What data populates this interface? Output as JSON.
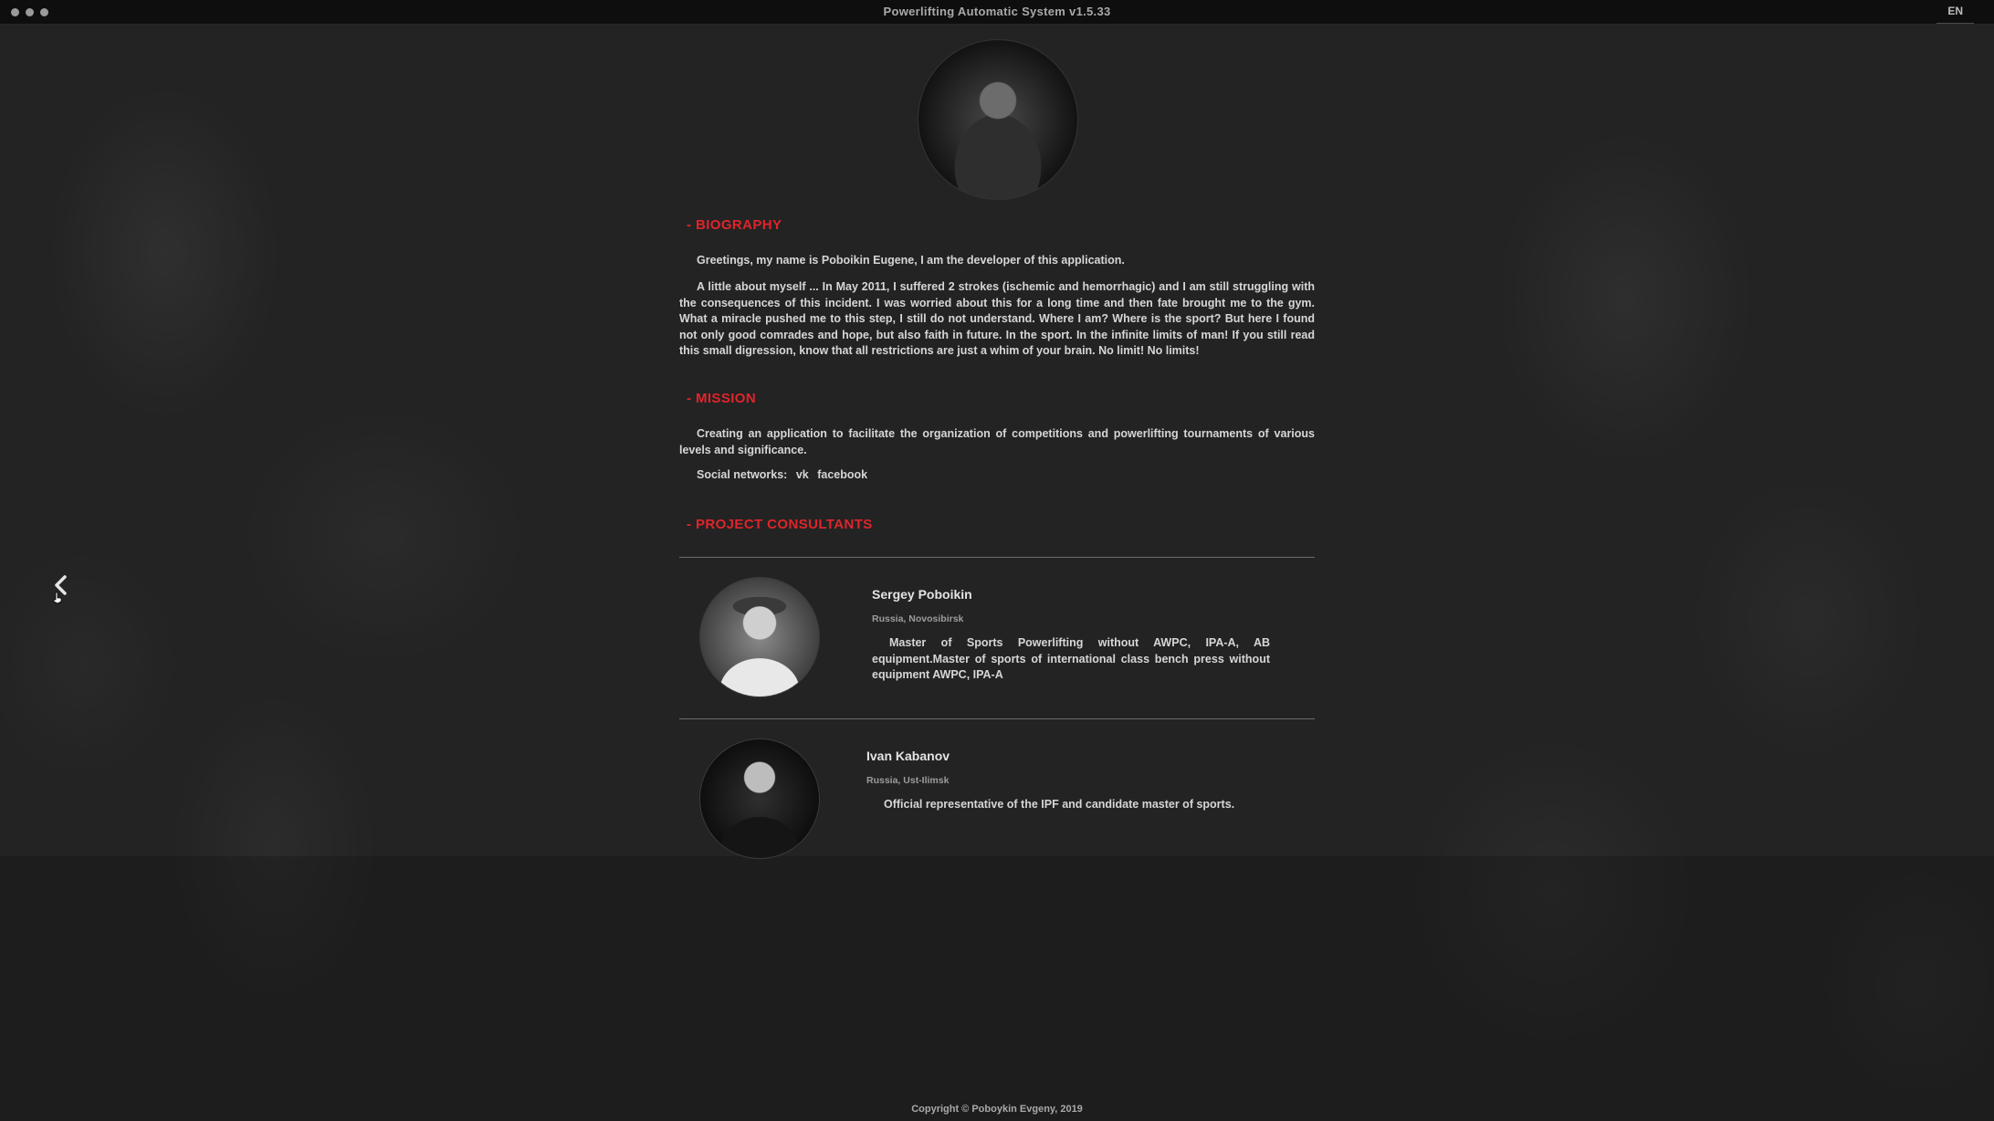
{
  "window": {
    "title": "Powerlifting Automatic System v1.5.33",
    "language": "EN"
  },
  "biography": {
    "title": "- BIOGRAPHY",
    "greeting": "Greetings, my name is Poboikin Eugene, I am the developer of this application.",
    "text": "A little about myself ... In May 2011, I suffered 2 strokes (ischemic and hemorrhagic) and I am still struggling with the consequences of this incident. I was worried about this for a long time and then fate brought me to the gym. What a miracle pushed me to this step, I still do not understand. Where I am? Where is the sport? But here I found not only good comrades and hope, but also faith in future. In the sport. In the infinite limits of man! If you still read this small digression, know that all restrictions are just a whim of your brain. No limit! No limits!"
  },
  "mission": {
    "title": "- MISSION",
    "text": "Creating an application to facilitate the organization of competitions and powerlifting tournaments of various levels and significance.",
    "social_label": "Social networks:",
    "social_links": [
      "vk",
      "facebook"
    ]
  },
  "consultants": {
    "title": "- PROJECT CONSULTANTS",
    "items": [
      {
        "name": "Sergey Poboikin",
        "location": "Russia, Novosibirsk",
        "description": "Master of Sports Powerlifting without AWPC, IPA-A, AB equipment.Master of sports of international class bench press without equipment AWPC, IPA-A"
      },
      {
        "name": "Ivan Kabanov",
        "location": "Russia, Ust-Ilimsk",
        "description": "Official representative of the IPF and candidate master of sports."
      }
    ]
  },
  "footer": {
    "copyright": "Copyright © Poboykin Evgeny, 2019"
  },
  "colors": {
    "accent": "#e0242b",
    "background": "#232323",
    "text": "#d6d6d6"
  },
  "icons": {
    "back": "chevron-left-icon",
    "cursor": "pointer-cursor-icon"
  }
}
